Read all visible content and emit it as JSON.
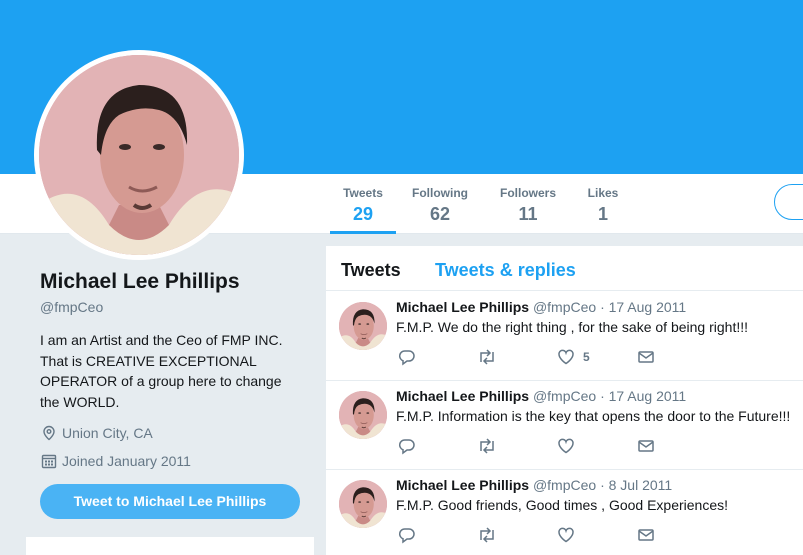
{
  "colors": {
    "brand": "#1da1f2",
    "button": "#4ab3f4",
    "muted": "#657786",
    "bg": "#e6ecf0"
  },
  "profile": {
    "name": "Michael Lee Phillips",
    "handle": "@fmpCeo",
    "bio": "I am an Artist and the Ceo of FMP INC. That is CREATIVE EXCEPTIONAL OPERATOR of a group here to change the WORLD.",
    "location": "Union City, CA",
    "joined": "Joined January 2011",
    "tweet_to_button": "Tweet to Michael Lee Phillips"
  },
  "stats": [
    {
      "label": "Tweets",
      "value": "29"
    },
    {
      "label": "Following",
      "value": "62"
    },
    {
      "label": "Followers",
      "value": "11"
    },
    {
      "label": "Likes",
      "value": "1"
    }
  ],
  "timeline": {
    "tabs": [
      {
        "label": "Tweets"
      },
      {
        "label": "Tweets & replies"
      }
    ],
    "tweets": [
      {
        "name": "Michael Lee Phillips",
        "handle": "@fmpCeo",
        "date": "· 17 Aug 2011",
        "text": "F.M.P. We do the right thing , for the sake of being right!!!",
        "likes": "5"
      },
      {
        "name": "Michael Lee Phillips",
        "handle": "@fmpCeo",
        "date": "· 17 Aug 2011",
        "text": "F.M.P. Information is the key that opens the door to the Future!!!",
        "likes": ""
      },
      {
        "name": "Michael Lee Phillips",
        "handle": "@fmpCeo",
        "date": "· 8 Jul 2011",
        "text": "F.M.P. Good friends, Good times , Good Experiences!",
        "likes": ""
      }
    ]
  },
  "icons": {
    "location": "location-pin-icon",
    "joined": "calendar-icon",
    "reply": "reply-icon",
    "retweet": "retweet-icon",
    "like": "heart-icon",
    "dm": "envelope-icon"
  }
}
